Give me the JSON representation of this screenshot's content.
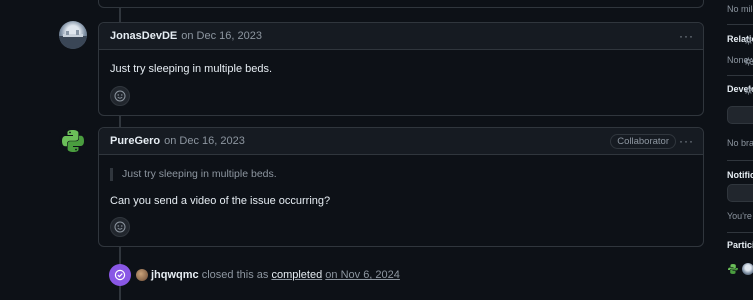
{
  "comments": [
    {
      "author": "JonasDevDE",
      "date_text": "on Dec 16, 2023",
      "body": "Just try sleeping in multiple beds.",
      "menu_icon": "···"
    },
    {
      "author": "PureGero",
      "date_text": "on Dec 16, 2023",
      "badge": "Collaborator",
      "quote": "Just try sleeping in multiple beds.",
      "body": "Can you send a video of the issue occurring?",
      "menu_icon": "···"
    }
  ],
  "event": {
    "user": "jhqwqmc",
    "action": "closed this as",
    "status": "completed",
    "date_text": "on Nov 6, 2024"
  },
  "sidebar": {
    "milestone_text": "No mile",
    "relationships_head": "Relatio",
    "relationships_text": "None y",
    "development_head": "Develo",
    "development_text": "No bra",
    "notifications_head": "Notific",
    "notifications_text": "You're",
    "participants_head": "Partici"
  },
  "colors": {
    "background": "#0d1117",
    "border": "#30363d",
    "closed_purple": "#8957e5",
    "muted_text": "#8d96a0"
  }
}
